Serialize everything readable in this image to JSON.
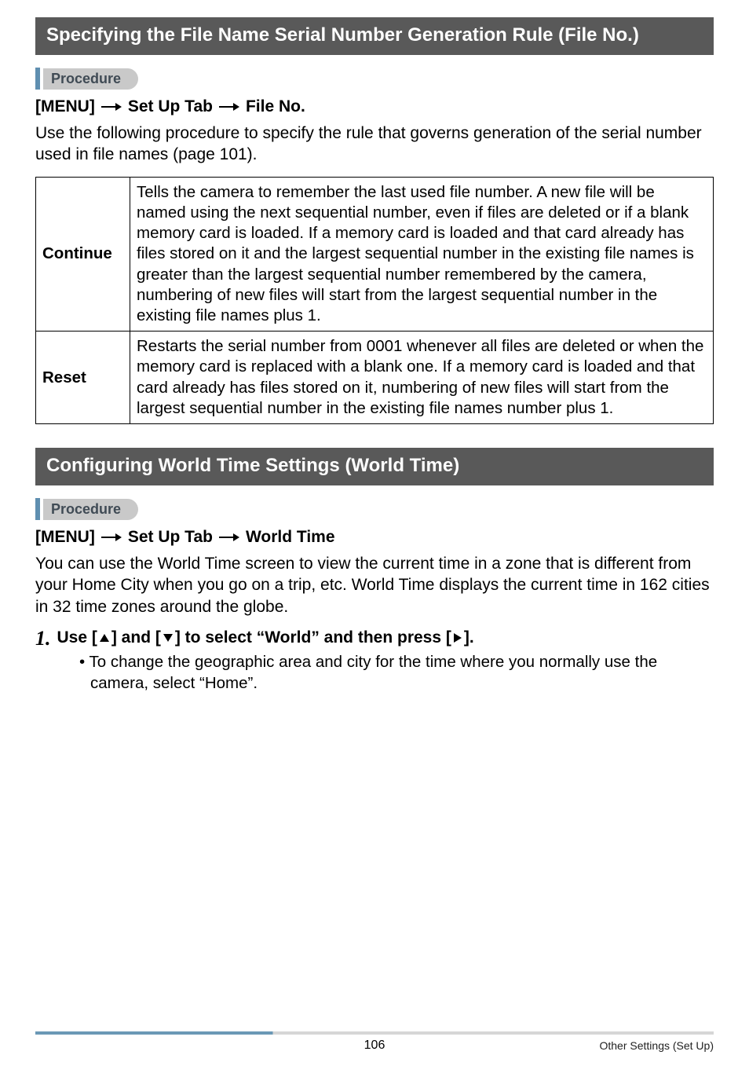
{
  "section1": {
    "title": "Specifying the File Name Serial Number Generation Rule (File No.)",
    "procedure_label": "Procedure",
    "menu_parts": [
      "[MENU]",
      "Set Up Tab",
      "File No."
    ],
    "intro": "Use the following procedure to specify the rule that governs generation of the serial number used in file names (page 101).",
    "rows": [
      {
        "label": "Continue",
        "text": "Tells the camera to remember the last used file number. A new file will be named using the next sequential number, even if files are deleted or if a blank memory card is loaded. If a memory card is loaded and that card already has files stored on it and the largest sequential number in the existing file names is greater than the largest sequential number remembered by the camera, numbering of new files will start from the largest sequential number in the existing file names plus 1."
      },
      {
        "label": "Reset",
        "text": "Restarts the serial number from 0001 whenever all files are deleted or when the memory card is replaced with a blank one. If a memory card is loaded and that card already has files stored on it, numbering of new files will start from the largest sequential number in the existing file names number plus 1."
      }
    ]
  },
  "section2": {
    "title": "Configuring World Time Settings (World Time)",
    "procedure_label": "Procedure",
    "menu_parts": [
      "[MENU]",
      "Set Up Tab",
      "World Time"
    ],
    "intro": "You can use the World Time screen to view the current time in a zone that is different from your Home City when you go on a trip, etc. World Time displays the current time in 162 cities in 32 time zones around the globe.",
    "step_num": "1.",
    "step_parts": {
      "a": "Use [",
      "b": "] and [",
      "c": "] to select “World” and then press [",
      "d": "]."
    },
    "bullet": "• To change the geographic area and city for the time where you normally use the camera, select “Home”."
  },
  "footer": {
    "page": "106",
    "label": "Other Settings (Set Up)"
  }
}
